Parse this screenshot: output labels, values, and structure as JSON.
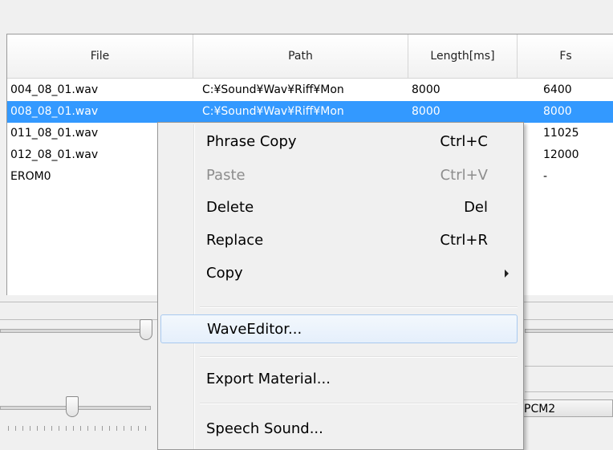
{
  "table": {
    "columns": [
      "File",
      "Path",
      "Length[ms]",
      "Fs"
    ],
    "rows": [
      {
        "file": "004_08_01.wav",
        "path": "C:¥Sound¥Wav¥Riff¥Mon",
        "length": "8000",
        "fs": "6400",
        "selected": false
      },
      {
        "file": "008_08_01.wav",
        "path": "C:¥Sound¥Wav¥Riff¥Mon",
        "length": "8000",
        "fs": "8000",
        "selected": true
      },
      {
        "file": "011_08_01.wav",
        "path": "",
        "length": "",
        "fs": "11025",
        "selected": false
      },
      {
        "file": "012_08_01.wav",
        "path": "",
        "length": "",
        "fs": "12000",
        "selected": false
      },
      {
        "file": "EROM0",
        "path": "",
        "length": "",
        "fs": "-",
        "selected": false
      }
    ]
  },
  "context_menu": {
    "items": [
      {
        "label": "Phrase Copy",
        "shortcut": "Ctrl+C"
      },
      {
        "label": "Paste",
        "shortcut": "Ctrl+V",
        "disabled": true
      },
      {
        "label": "Delete",
        "shortcut": "Del"
      },
      {
        "label": "Replace",
        "shortcut": "Ctrl+R"
      },
      {
        "label": "Copy",
        "submenu": true
      },
      {
        "label": "WaveEditor...",
        "highlighted": true
      },
      {
        "label": "Export Material..."
      },
      {
        "label": "Speech Sound..."
      }
    ]
  },
  "lower_panel": {
    "pcm_label": "PCM2"
  },
  "colors": {
    "selection": "#3399ff",
    "menu_hover_border": "#a8c9ef"
  }
}
